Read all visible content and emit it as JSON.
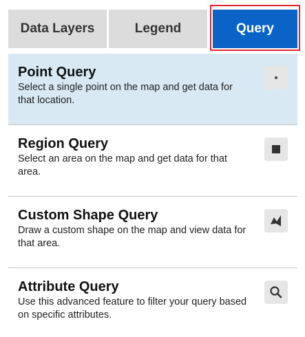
{
  "tabs": {
    "data_layers": "Data Layers",
    "legend": "Legend",
    "query": "Query",
    "active": "Query"
  },
  "queries": [
    {
      "title": "Point Query",
      "description": "Select a single point on the map and get data for that location.",
      "icon": "point-icon",
      "selected": true
    },
    {
      "title": "Region Query",
      "description": "Select an area on the map and get data for that area.",
      "icon": "square-icon",
      "selected": false
    },
    {
      "title": "Custom Shape Query",
      "description": "Draw a custom shape on the map and view data for that area.",
      "icon": "polygon-icon",
      "selected": false
    },
    {
      "title": "Attribute Query",
      "description": "Use this advanced feature to filter your query based on specific attributes.",
      "icon": "search-icon",
      "selected": false
    }
  ],
  "colors": {
    "accent": "#0a64c8",
    "highlight_border": "#e3242b",
    "selected_row": "#d8e9f4",
    "tab_inactive": "#dcdcdc",
    "icon_button": "#e6e6e6"
  }
}
